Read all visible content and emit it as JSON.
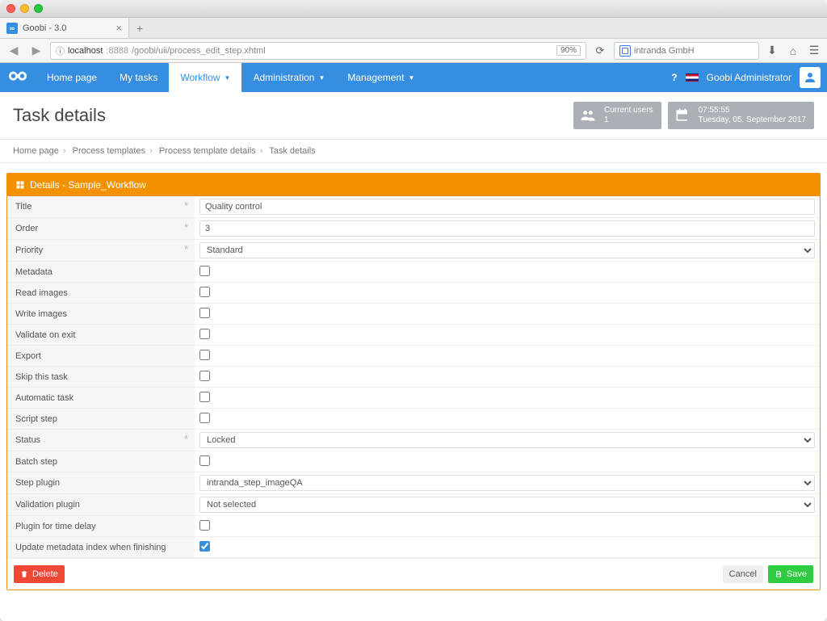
{
  "browser": {
    "tab_title": "Goobi - 3.0",
    "url_host": "localhost",
    "url_port": ":8888",
    "url_path": "/goobi/uii/process_edit_step.xhtml",
    "zoom": "90%",
    "search_placeholder": "intranda GmbH"
  },
  "nav": {
    "items": [
      {
        "label": "Home page",
        "active": false,
        "dropdown": false
      },
      {
        "label": "My tasks",
        "active": false,
        "dropdown": false
      },
      {
        "label": "Workflow",
        "active": true,
        "dropdown": true
      },
      {
        "label": "Administration",
        "active": false,
        "dropdown": true
      },
      {
        "label": "Management",
        "active": false,
        "dropdown": true
      }
    ],
    "admin_label": "Goobi Administrator"
  },
  "header": {
    "title": "Task details",
    "users_widget": {
      "label": "Current users",
      "count": "1"
    },
    "time_widget": {
      "time": "07:55:55",
      "date": "Tuesday, 05. September 2017"
    }
  },
  "breadcrumb": [
    "Home page",
    "Process templates",
    "Process template details",
    "Task details"
  ],
  "panel": {
    "title": "Details - Sample_Workflow"
  },
  "form": {
    "title": {
      "label": "Title",
      "value": "Quality control",
      "required": true
    },
    "order": {
      "label": "Order",
      "value": "3",
      "required": true
    },
    "priority": {
      "label": "Priority",
      "value": "Standard",
      "required": true
    },
    "metadata": {
      "label": "Metadata",
      "checked": false
    },
    "read_images": {
      "label": "Read images",
      "checked": false
    },
    "write_images": {
      "label": "Write images",
      "checked": false
    },
    "validate_on_exit": {
      "label": "Validate on exit",
      "checked": false
    },
    "export": {
      "label": "Export",
      "checked": false
    },
    "skip_this_task": {
      "label": "Skip this task",
      "checked": false
    },
    "automatic_task": {
      "label": "Automatic task",
      "checked": false
    },
    "script_step": {
      "label": "Script step",
      "checked": false
    },
    "status": {
      "label": "Status",
      "value": "Locked",
      "required": true
    },
    "batch_step": {
      "label": "Batch step",
      "checked": false
    },
    "step_plugin": {
      "label": "Step plugin",
      "value": "intranda_step_imageQA"
    },
    "validation_plugin": {
      "label": "Validation plugin",
      "value": "Not selected"
    },
    "plugin_time_delay": {
      "label": "Plugin for time delay",
      "checked": false
    },
    "update_metadata": {
      "label": "Update metadata index when finishing",
      "checked": true
    }
  },
  "buttons": {
    "delete": "Delete",
    "cancel": "Cancel",
    "save": "Save"
  }
}
